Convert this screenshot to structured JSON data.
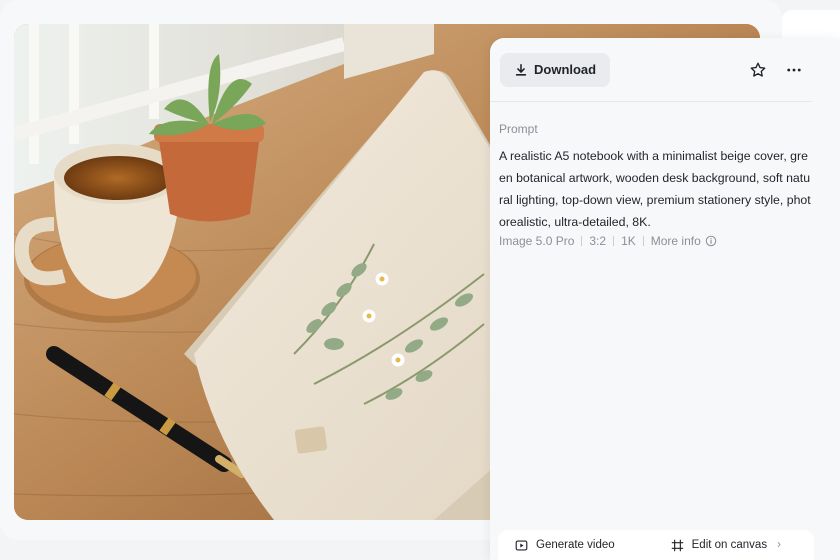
{
  "actions": {
    "download_label": "Download",
    "favorite_icon": "star-icon",
    "more_icon": "more-horizontal-icon"
  },
  "prompt": {
    "label": "Prompt",
    "text": "A realistic A5 notebook with a minimalist beige cover, green botanical artwork, wooden desk background, soft natural lighting, top-down view, premium stationery style, photorealistic, ultra-detailed, 8K."
  },
  "meta": {
    "model": "Image 5.0 Pro",
    "ratio": "3:2",
    "resolution": "1K",
    "more_info": "More info"
  },
  "bottom_bar": {
    "generate_video": "Generate video",
    "edit_on_canvas": "Edit on canvas",
    "chevron": "›"
  },
  "colors": {
    "panel_bg": "#f7f8fa",
    "button_bg": "#e9ebef",
    "text_primary": "#1f2329",
    "text_secondary": "#8a8f98"
  }
}
